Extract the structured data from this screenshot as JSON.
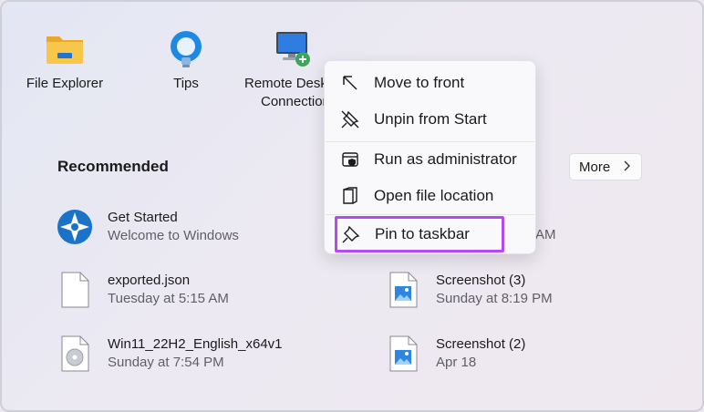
{
  "pinned": [
    {
      "label": "File Explorer",
      "icon": "folder-icon"
    },
    {
      "label": "Tips",
      "icon": "lightbulb-icon"
    },
    {
      "label_line1": "Remote Desk",
      "label_line2": "Connection",
      "icon": "remote-desktop-icon"
    }
  ],
  "recommended": {
    "title": "Recommended",
    "more_label": "More",
    "items": [
      {
        "title": "Get Started",
        "subtitle": "Welcome to Windows",
        "icon": "get-started-icon"
      },
      {
        "title": "exported.json",
        "subtitle": "Tuesday at 5:15 AM",
        "icon": "file-icon"
      },
      {
        "title": "Screenshot (3)",
        "subtitle": "Sunday at 8:19 PM",
        "icon": "image-file-icon"
      },
      {
        "title": "Win11_22H2_English_x64v1",
        "subtitle": "Sunday at 7:54 PM",
        "icon": "disc-image-icon"
      },
      {
        "title": "Screenshot (2)",
        "subtitle": "Apr 18",
        "icon": "image-file-icon"
      }
    ],
    "partial_time": "AM"
  },
  "context_menu": {
    "items": [
      {
        "label": "Move to front",
        "icon": "arrow-up-left-icon"
      },
      {
        "label": "Unpin from Start",
        "icon": "unpin-icon"
      },
      {
        "label": "Run as administrator",
        "icon": "shield-icon"
      },
      {
        "label": "Open file location",
        "icon": "folder-location-icon"
      },
      {
        "label": "Pin to taskbar",
        "icon": "pin-icon"
      }
    ]
  },
  "colors": {
    "highlight_border": "#b24cf0",
    "folder_yellow": "#f7c64a",
    "tips_blue": "#1e88e5"
  }
}
